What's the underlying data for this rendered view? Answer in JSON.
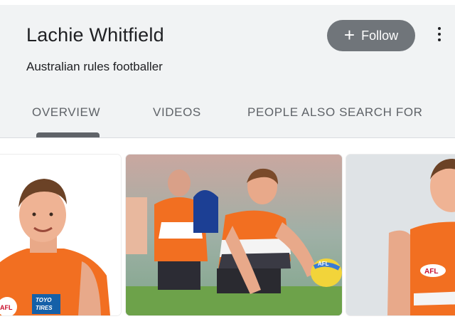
{
  "entity": {
    "name": "Lachie Whitfield",
    "description": "Australian rules footballer"
  },
  "actions": {
    "follow_label": "Follow",
    "follow_icon": "plus-icon",
    "more_icon": "more-vert-icon"
  },
  "tabs": [
    {
      "label": "OVERVIEW",
      "active": true
    },
    {
      "label": "VIDEOS",
      "active": false
    },
    {
      "label": "PEOPLE ALSO SEARCH FOR",
      "active": false
    }
  ],
  "images": {
    "card1": {
      "logo_text": "AFL",
      "sponsor_line1": "TOYO",
      "sponsor_line2": "TIRES"
    },
    "card2": {
      "ball_text": "AFL"
    },
    "card3": {
      "logo_text": "AFL"
    }
  },
  "colors": {
    "header_bg": "#f1f3f4",
    "follow_bg": "#70757a",
    "jersey_orange": "#f26f21",
    "tab_text": "#5f6368"
  }
}
